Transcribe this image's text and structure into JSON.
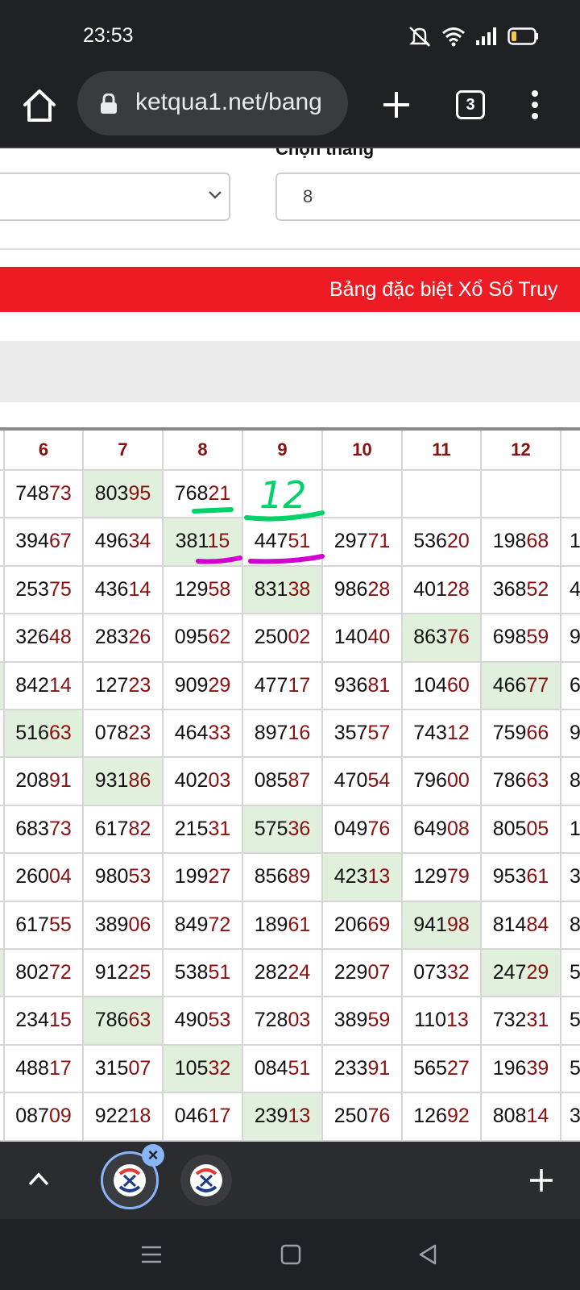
{
  "status": {
    "time": "23:53"
  },
  "browser": {
    "url": "ketqua1.net/bang",
    "tab_count": "3"
  },
  "form": {
    "month_label": "Chọn tháng",
    "month_value": "8"
  },
  "banner": {
    "text": "Bảng đặc biệt Xổ Số Truy"
  },
  "table": {
    "headers": [
      "6",
      "7",
      "8",
      "9",
      "10",
      "11",
      "12"
    ],
    "rows": [
      [
        "74873",
        "80395",
        "76821",
        "",
        "",
        "",
        ""
      ],
      [
        "39467",
        "49634",
        "38115",
        "44751",
        "29771",
        "53620",
        "19868"
      ],
      [
        "25375",
        "43614",
        "12958",
        "83138",
        "98628",
        "40128",
        "36852"
      ],
      [
        "32648",
        "28326",
        "09562",
        "25002",
        "14040",
        "86376",
        "69859"
      ],
      [
        "84214",
        "12723",
        "90929",
        "47717",
        "93681",
        "10460",
        "46677"
      ],
      [
        "51663",
        "07823",
        "46433",
        "89716",
        "35757",
        "74312",
        "75966"
      ],
      [
        "20891",
        "93186",
        "40203",
        "08587",
        "47054",
        "79600",
        "78663"
      ],
      [
        "68373",
        "61782",
        "21531",
        "57536",
        "04976",
        "64908",
        "80505"
      ],
      [
        "26004",
        "98053",
        "19927",
        "85689",
        "42313",
        "12979",
        "95361"
      ],
      [
        "61755",
        "38906",
        "84972",
        "18961",
        "20669",
        "94198",
        "81484"
      ],
      [
        "80272",
        "91225",
        "53851",
        "28224",
        "22907",
        "07332",
        "24729"
      ],
      [
        "23415",
        "78663",
        "49053",
        "72803",
        "38959",
        "11013",
        "73231"
      ],
      [
        "48817",
        "31507",
        "10532",
        "08451",
        "23391",
        "56527",
        "19639"
      ],
      [
        "08709",
        "92218",
        "04617",
        "23913",
        "25076",
        "12692",
        "80814"
      ]
    ],
    "right_edge": [
      "",
      "1",
      "4",
      "9",
      "6",
      "9",
      "8",
      "1",
      "3",
      "8",
      "5",
      "5",
      "5",
      "3"
    ],
    "highlighted": [
      [
        0,
        1
      ],
      [
        1,
        2
      ],
      [
        2,
        3
      ],
      [
        3,
        5
      ],
      [
        4,
        6
      ],
      [
        5,
        0
      ],
      [
        6,
        1
      ],
      [
        7,
        3
      ],
      [
        8,
        4
      ],
      [
        9,
        5
      ],
      [
        10,
        6
      ],
      [
        11,
        1
      ],
      [
        12,
        2
      ],
      [
        13,
        3
      ]
    ],
    "left_edge_highlighted_rows": [
      4,
      10
    ]
  },
  "annotation": {
    "handwritten": "12",
    "underline_green": "#00d26a",
    "underline_magenta": "#d100d1"
  },
  "colors": {
    "banner": "#ed1c24",
    "highlight": "#e1f0dc",
    "tail_digits": "#8b0f0f"
  }
}
